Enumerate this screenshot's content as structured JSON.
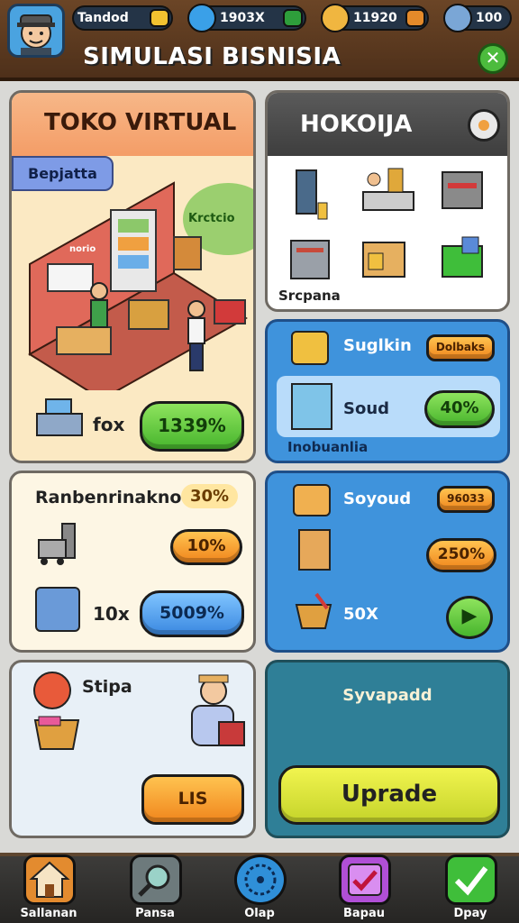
{
  "header": {
    "title": "SIMULASI BISNISIA",
    "resources": [
      {
        "name": "energy",
        "value": "Tandod",
        "color": "#f2c230"
      },
      {
        "name": "gems",
        "value": "1903X",
        "color": "#2e9e3b"
      },
      {
        "name": "coins",
        "value": "11920",
        "color": "#e48a2a"
      },
      {
        "name": "cash",
        "value": "100",
        "color": "#2e9e3b"
      }
    ]
  },
  "toko": {
    "title": "TOKO VIRTUAL",
    "tag": "Bepjatta",
    "scene_label": "Krctcio",
    "scene_sign": "norio",
    "stat_label": "fox",
    "stat_button": "1339%"
  },
  "hoko": {
    "title": "HOKOIJA",
    "caption": "Srcpana"
  },
  "upgrades": {
    "row1_label": "Suglkin",
    "row1_badge": "Dolbaks",
    "row2_label": "Soud",
    "row2_button": "40%",
    "footer": "Inobuanlia"
  },
  "finance": {
    "title": "Ranbenrinakno",
    "badge": "30%",
    "row1_button": "10%",
    "row2_label": "10x",
    "row2_button": "5009%"
  },
  "supply": {
    "row1_label": "Soyoud",
    "row1_badge": "96033",
    "row2_badge": "250%",
    "row3_label": "50X"
  },
  "stipa": {
    "title": "Stipa",
    "button": "LIS"
  },
  "upgrade_panel": {
    "title": "Syvapadd",
    "button": "Uprade"
  },
  "nav": [
    {
      "label": "Sallanan",
      "icon": "home-icon",
      "color": "#e38b2f"
    },
    {
      "label": "Pansa",
      "icon": "search-icon",
      "color": "#6d7a7c"
    },
    {
      "label": "Olap",
      "icon": "globe-icon",
      "color": "#2f8fd8"
    },
    {
      "label": "Bapau",
      "icon": "clipboard-check-icon",
      "color": "#b04fd6"
    },
    {
      "label": "Dpay",
      "icon": "checkmark-icon",
      "color": "#3fbe3a"
    }
  ]
}
